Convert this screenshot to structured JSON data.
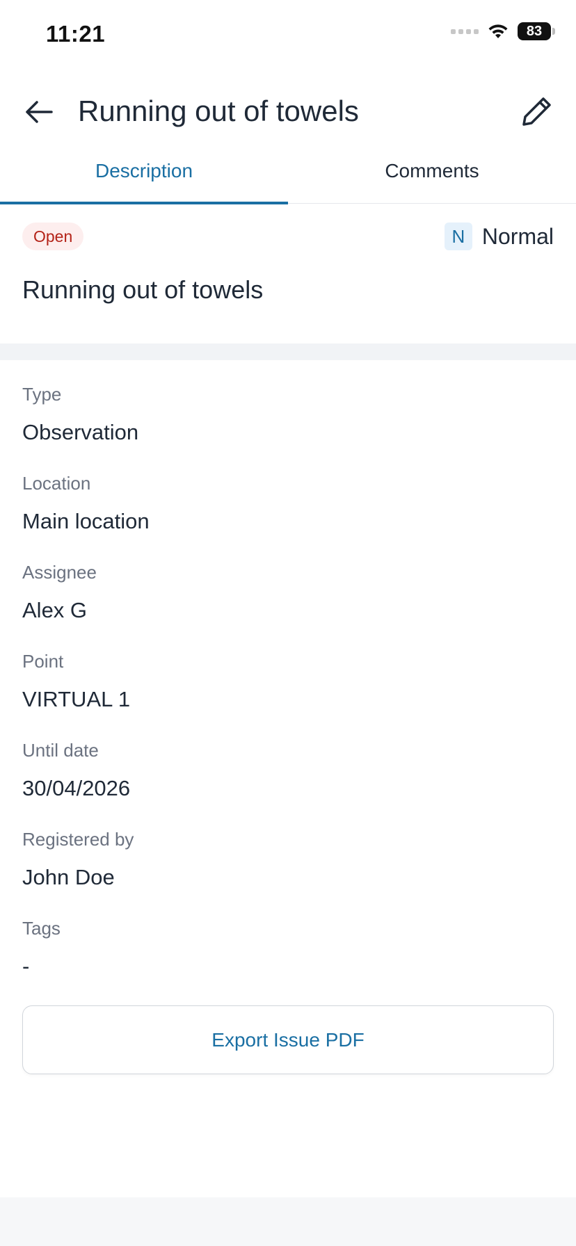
{
  "status_bar": {
    "time": "11:21",
    "battery": "83"
  },
  "header": {
    "title": "Running out of towels"
  },
  "tabs": [
    {
      "label": "Description",
      "active": true
    },
    {
      "label": "Comments",
      "active": false
    }
  ],
  "issue": {
    "status": "Open",
    "priority_letter": "N",
    "priority_label": "Normal",
    "title": "Running out of towels"
  },
  "fields": [
    {
      "label": "Type",
      "value": "Observation"
    },
    {
      "label": "Location",
      "value": "Main location"
    },
    {
      "label": "Assignee",
      "value": "Alex G"
    },
    {
      "label": "Point",
      "value": "VIRTUAL 1"
    },
    {
      "label": "Until date",
      "value": "30/04/2026"
    },
    {
      "label": "Registered by",
      "value": "John Doe"
    },
    {
      "label": "Tags",
      "value": "-"
    }
  ],
  "actions": {
    "export_label": "Export Issue PDF"
  },
  "colors": {
    "accent": "#1a6fa3",
    "status_open_bg": "#fdeeee",
    "status_open_text": "#b42318"
  },
  "icons": {
    "back": "arrow-left-icon",
    "edit": "pencil-icon",
    "wifi": "wifi-icon",
    "battery": "battery-icon",
    "signal": "signal-icon"
  }
}
